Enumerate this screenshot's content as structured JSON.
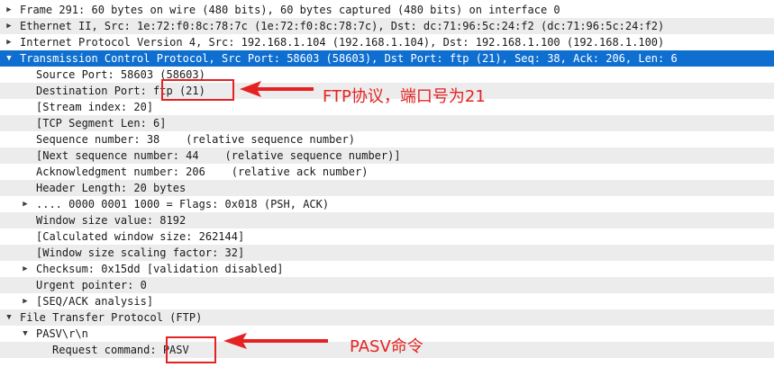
{
  "rows": [
    {
      "text": "Frame 291: 60 bytes on wire (480 bits), 60 bytes captured (480 bits) on interface 0",
      "depth": 0,
      "expander": "collapsed"
    },
    {
      "text": "Ethernet II, Src: 1e:72:f0:8c:78:7c (1e:72:f0:8c:78:7c), Dst: dc:71:96:5c:24:f2 (dc:71:96:5c:24:f2)",
      "depth": 0,
      "expander": "collapsed"
    },
    {
      "text": "Internet Protocol Version 4, Src: 192.168.1.104 (192.168.1.104), Dst: 192.168.1.100 (192.168.1.100)",
      "depth": 0,
      "expander": "collapsed"
    },
    {
      "text": "Transmission Control Protocol, Src Port: 58603 (58603), Dst Port: ftp (21), Seq: 38, Ack: 206, Len: 6",
      "depth": 0,
      "expander": "expanded",
      "selected": true
    },
    {
      "text": "Source Port: 58603 (58603)",
      "depth": 1,
      "expander": "none"
    },
    {
      "text": "Destination Port: ftp (21)",
      "depth": 1,
      "expander": "none"
    },
    {
      "text": "[Stream index: 20]",
      "depth": 1,
      "expander": "none"
    },
    {
      "text": "[TCP Segment Len: 6]",
      "depth": 1,
      "expander": "none"
    },
    {
      "text": "Sequence number: 38    (relative sequence number)",
      "depth": 1,
      "expander": "none"
    },
    {
      "text": "[Next sequence number: 44    (relative sequence number)]",
      "depth": 1,
      "expander": "none"
    },
    {
      "text": "Acknowledgment number: 206    (relative ack number)",
      "depth": 1,
      "expander": "none"
    },
    {
      "text": "Header Length: 20 bytes",
      "depth": 1,
      "expander": "none"
    },
    {
      "text": ".... 0000 0001 1000 = Flags: 0x018 (PSH, ACK)",
      "depth": 1,
      "expander": "collapsed"
    },
    {
      "text": "Window size value: 8192",
      "depth": 1,
      "expander": "none"
    },
    {
      "text": "[Calculated window size: 262144]",
      "depth": 1,
      "expander": "none"
    },
    {
      "text": "[Window size scaling factor: 32]",
      "depth": 1,
      "expander": "none"
    },
    {
      "text": "Checksum: 0x15dd [validation disabled]",
      "depth": 1,
      "expander": "collapsed"
    },
    {
      "text": "Urgent pointer: 0",
      "depth": 1,
      "expander": "none"
    },
    {
      "text": "[SEQ/ACK analysis]",
      "depth": 1,
      "expander": "collapsed"
    },
    {
      "text": "File Transfer Protocol (FTP)",
      "depth": 0,
      "expander": "expanded"
    },
    {
      "text": "PASV\\r\\n",
      "depth": 1,
      "expander": "expanded"
    },
    {
      "text": "Request command: PASV",
      "depth": 2,
      "expander": "none"
    }
  ],
  "annotations": [
    {
      "label": "FTP协议，端口号为21"
    },
    {
      "label": "PASV命令"
    }
  ],
  "colors": {
    "selection": "#0f6fd1",
    "alt_row": "#ececec",
    "annotation_red": "#e52222"
  }
}
